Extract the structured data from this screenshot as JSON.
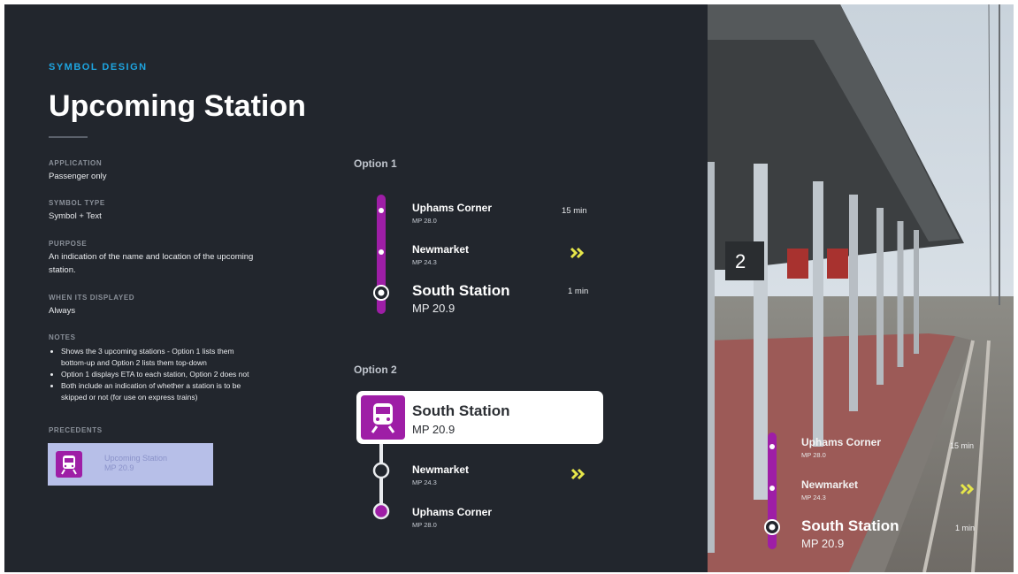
{
  "header": {
    "eyebrow": "SYMBOL DESIGN",
    "title": "Upcoming Station"
  },
  "specs": {
    "application_label": "APPLICATION",
    "application_value": "Passenger only",
    "symbol_type_label": "SYMBOL TYPE",
    "symbol_type_value": "Symbol + Text",
    "purpose_label": "PURPOSE",
    "purpose_value_1": "An indication of the name and location of the upcoming",
    "purpose_value_2": "station.",
    "when_label": "WHEN ITS DISPLAYED",
    "when_value": "Always",
    "notes_label": "NOTES",
    "notes": [
      "Shows the 3 upcoming stations - Option 1 lists them",
      "bottom-up and Option 2 lists them top-down",
      "Option 1 displays ETA to each station, Option 2 does not",
      "Both include an indication of whether a station is to be",
      "skipped or not (for use on express trains)"
    ],
    "precedents_label": "PRECEDENTS",
    "precedent_text_1": "Upcoming Station",
    "precedent_text_2": "MP 20.9"
  },
  "option1": {
    "label": "Option 1",
    "stations": [
      {
        "name": "Uphams Corner",
        "mp": "MP 28.0",
        "eta": "15 min"
      },
      {
        "name": "Newmarket",
        "mp": "MP 24.3",
        "eta": "»"
      },
      {
        "name": "South Station",
        "mp": "MP 20.9",
        "eta": "1 min"
      }
    ]
  },
  "option2": {
    "label": "Option 2",
    "card_name": "South Station",
    "card_mp": "MP 20.9",
    "stations": [
      {
        "name": "Newmarket",
        "mp": "MP 24.3"
      },
      {
        "name": "Uphams Corner",
        "mp": "MP 28.0"
      }
    ]
  },
  "photo": {
    "platform_number": "2",
    "overlay": [
      {
        "name": "Uphams Corner",
        "mp": "MP 28.0",
        "eta": "15 min"
      },
      {
        "name": "Newmarket",
        "mp": "MP 24.3"
      },
      {
        "name": "South Station",
        "mp": "MP 20.9",
        "eta": "1 min"
      }
    ]
  },
  "colors": {
    "panel_bg": "#22262d",
    "accent_blue": "#1ea5e0",
    "line_purple": "#9e1ea6",
    "skip_yellow": "#e6e64a"
  },
  "icons": [
    "train-icon",
    "chevron-double-right-icon",
    "current-station-icon"
  ]
}
